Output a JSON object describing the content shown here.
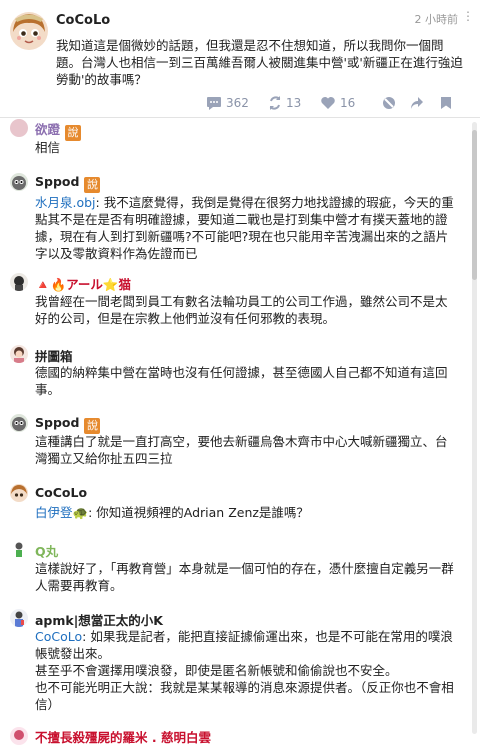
{
  "post": {
    "author": "CoCoLo",
    "time": "2 小時前",
    "body": "我知道這是個微妙的話題，但我還是忍不住想知道，所以我問你一個問題。台灣人也相信一到三百萬維吾爾人被關進集中營'或'新疆正在進行強迫勞動'的故事嗎？",
    "stats": {
      "views": "362",
      "reposts": "13",
      "likes": "16"
    }
  },
  "replies": [
    {
      "name": "欲蹬",
      "badge": "說",
      "text": "相信"
    },
    {
      "name": "Sppod",
      "badge": "說",
      "mention": "水月泉.obj",
      "text": ": 我不這麼覺得，我倒是覺得在很努力地找證據的瑕疵，今天的重點其不是在是否有明確證據，要知道二戰也是打到集中營才有撲天蓋地的證據，現在有人到打到新疆嗎?不可能吧?現在也只能用辛苦洩漏出來的之語片字以及零散資料作為佐證而已"
    },
    {
      "name": "🔺🔥アール⭐猫",
      "text": "我曾經在一間老闆到員工有數名法輪功員工的公司工作過，雖然公司不是太好的公司，但是在宗教上他們並沒有任何邪教的表現。"
    },
    {
      "name": "拼圖箱",
      "text": "德國的納粹集中營在當時也沒有任何證據，甚至德國人自己都不知道有這回事。"
    },
    {
      "name": "Sppod",
      "badge": "說",
      "text": "這種講白了就是一直打高空，要他去新疆烏魯木齊市中心大喊新疆獨立、台灣獨立又給你扯五四三拉"
    },
    {
      "name": "CoCoLo",
      "mention": "白伊登🐢",
      "text": ": 你知道視頻裡的Adrian Zenz是誰嗎？"
    },
    {
      "name": "Q丸",
      "text": "這樣說好了，「再教育營」本身就是一個可怕的存在，憑什麼擅自定義另一群人需要再教育。"
    },
    {
      "name": "apmk|想當正太的小K",
      "mention": "CoCoLo",
      "text": ": 如果我是記者，能把直接証據偷運出來，也是不可能在常用的噗浪帳號發出來。\n甚至乎不會選擇用噗浪發，即使是匿名新帳號和偷偷說也不安全。\n也不可能光明正大說：我就是某某報導的消息來源提供者。（反正你也不會相信）"
    },
    {
      "name": "不擅長殺殭屍的羅米 . 慈明白雲"
    }
  ]
}
